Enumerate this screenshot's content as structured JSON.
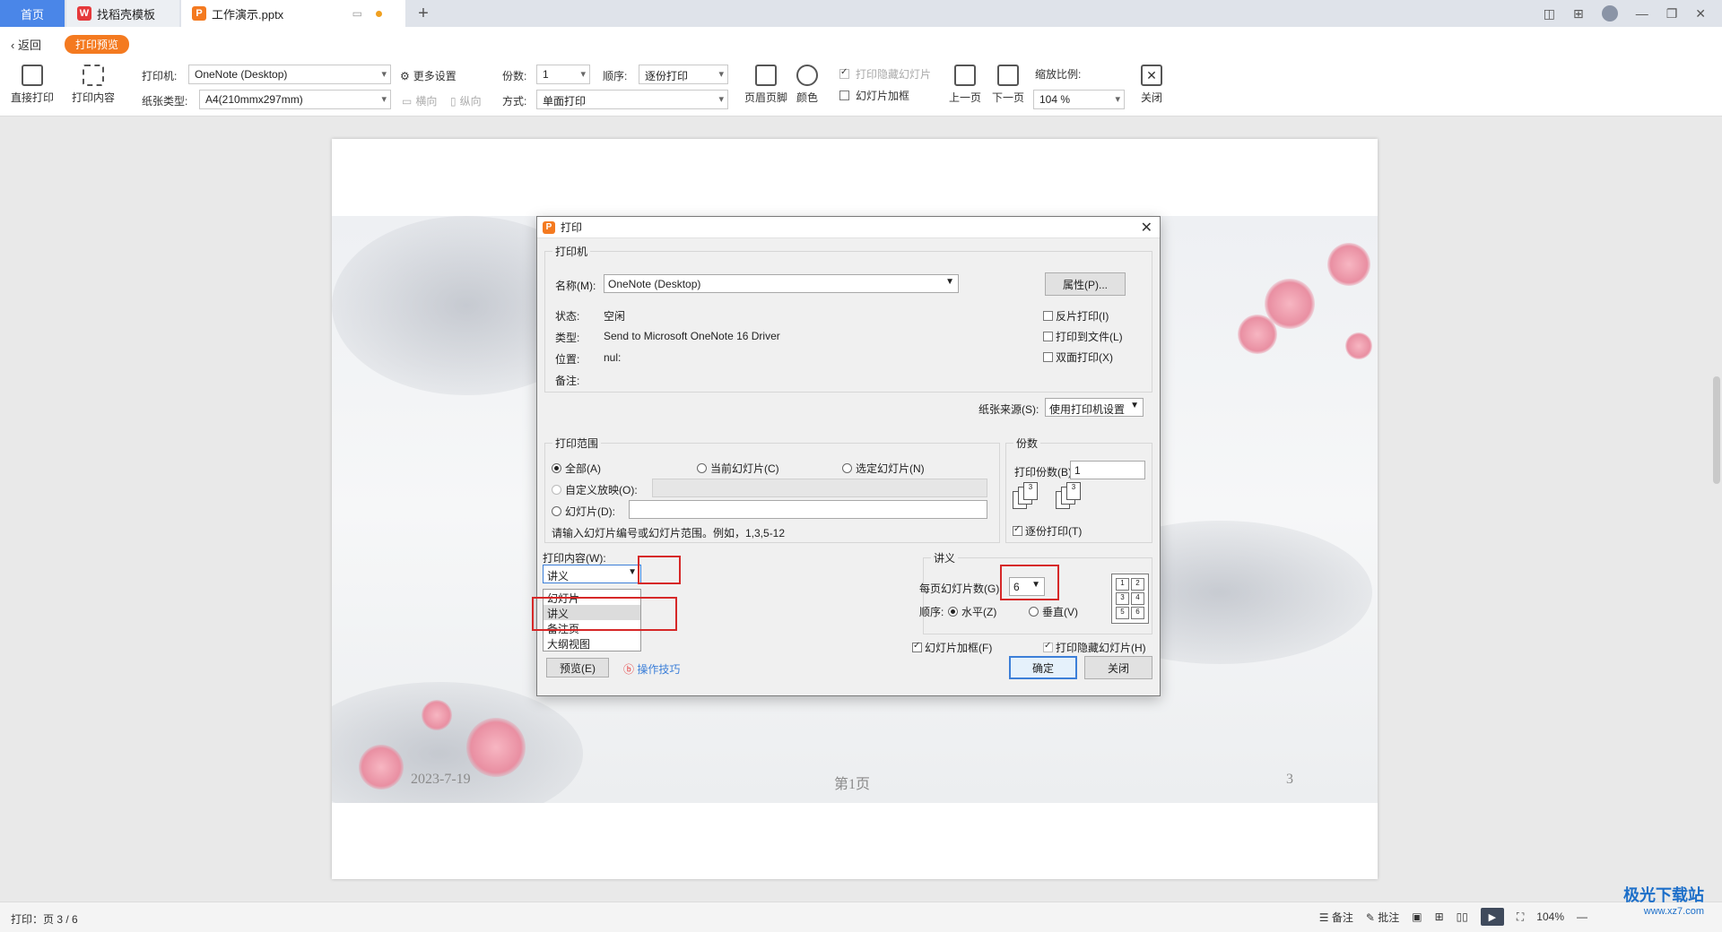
{
  "tabs": {
    "home": "首页",
    "daoke": "找稻壳模板",
    "doc": "工作演示.pptx"
  },
  "toolbar": {
    "back": "返回",
    "mode_badge": "打印预览",
    "direct_print": "直接打印",
    "print_content": "打印内容",
    "printer_label": "打印机:",
    "printer_value": "OneNote (Desktop)",
    "more_settings": "更多设置",
    "paper_label": "纸张类型:",
    "paper_value": "A4(210mmx297mm)",
    "landscape": "横向",
    "portrait": "纵向",
    "copies_label": "份数:",
    "copies_value": "1",
    "order_label": "顺序:",
    "order_value": "逐份打印",
    "method_label": "方式:",
    "method_value": "单面打印",
    "header_footer": "页眉页脚",
    "color": "颜色",
    "print_hidden": "打印隐藏幻灯片",
    "slide_frame": "幻灯片加框",
    "prev_page": "上一页",
    "next_page": "下一页",
    "zoom_label": "缩放比例:",
    "zoom_value": "104 %",
    "close": "关闭"
  },
  "slide": {
    "date": "2023-7-19",
    "page_label": "第1页",
    "number": "3"
  },
  "dialog": {
    "title": "打印",
    "printer_group": "打印机",
    "name_label": "名称(M):",
    "name_value": "OneNote (Desktop)",
    "properties_button": "属性(P)...",
    "status_label": "状态:",
    "status_value": "空闲",
    "type_label": "类型:",
    "type_value": "Send to Microsoft OneNote 16 Driver",
    "location_label": "位置:",
    "location_value": "nul:",
    "comment_label": "备注:",
    "reverse_print": "反片打印(I)",
    "print_to_file": "打印到文件(L)",
    "duplex": "双面打印(X)",
    "paper_source_label": "纸张来源(S):",
    "paper_source_value": "使用打印机设置",
    "range_group": "打印范围",
    "range_all": "全部(A)",
    "range_current": "当前幻灯片(C)",
    "range_selected": "选定幻灯片(N)",
    "range_custom": "自定义放映(O):",
    "range_slides": "幻灯片(D):",
    "range_hint": "请输入幻灯片编号或幻灯片范围。例如，1,3,5-12",
    "copies_group": "份数",
    "copies_label": "打印份数(B):",
    "copies_value": "1",
    "collate": "逐份打印(T)",
    "content_label": "打印内容(W):",
    "content_value": "讲义",
    "content_options": [
      "幻灯片",
      "讲义",
      "备注页",
      "大纲视图"
    ],
    "handout_group": "讲义",
    "per_page_label": "每页幻灯片数(G):",
    "per_page_value": "6",
    "order_label": "顺序:",
    "order_horizontal": "水平(Z)",
    "order_vertical": "垂直(V)",
    "frame_slides": "幻灯片加框(F)",
    "print_hidden": "打印隐藏幻灯片(H)",
    "preview_button": "预览(E)",
    "tips_link": "操作技巧",
    "ok_button": "确定",
    "close_button": "关闭"
  },
  "statusbar": {
    "page_info": "打印：页 3 / 6",
    "notes": "备注",
    "comments": "批注",
    "zoom": "104%"
  },
  "watermark": {
    "brand": "极光下载站",
    "url": "www.xz7.com"
  },
  "colors": {
    "accent_orange": "#f47a20",
    "highlight_red": "#d62828",
    "home_tab_blue": "#4a86e8"
  }
}
